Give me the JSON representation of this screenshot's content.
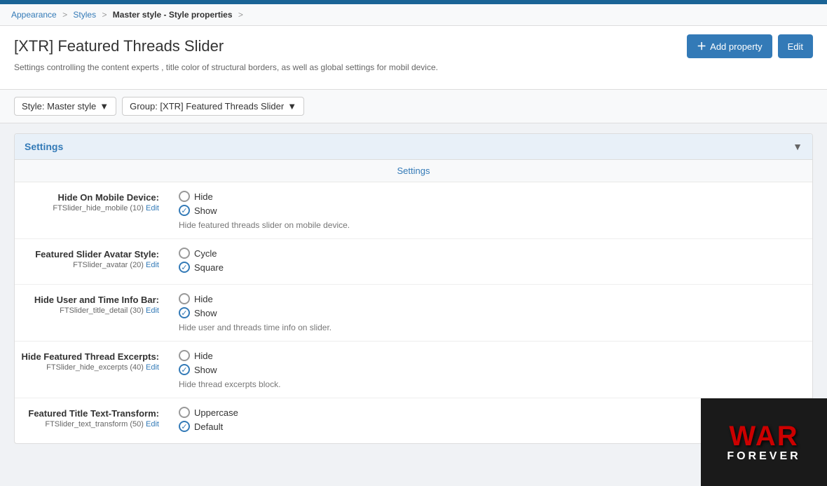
{
  "topbar": {
    "color": "#1a6496"
  },
  "breadcrumb": {
    "items": [
      {
        "label": "Appearance",
        "link": true
      },
      {
        "label": "Styles",
        "link": true
      },
      {
        "label": "Master style - Style properties",
        "link": true,
        "bold": true
      }
    ],
    "separator": ">"
  },
  "header": {
    "title": "[XTR] Featured Threads Slider",
    "description": "Settings controlling the content experts , title color of structural borders, as well as global settings for mobil device.",
    "add_property_label": "Add property",
    "edit_label": "Edit"
  },
  "filters": {
    "style_label": "Style: Master style",
    "group_label": "Group: [XTR] Featured Threads Slider"
  },
  "settings_panel": {
    "title": "Settings",
    "sub_header": "Settings",
    "rows": [
      {
        "label": "Hide On Mobile Device:",
        "sub": "FTSlider_hide_mobile (10)",
        "edit_link": "Edit",
        "options": [
          {
            "label": "Hide",
            "selected": false
          },
          {
            "label": "Show",
            "selected": true
          }
        ],
        "hint": "Hide featured threads slider on mobile device."
      },
      {
        "label": "Featured Slider Avatar Style:",
        "sub": "FTSlider_avatar (20)",
        "edit_link": "Edit",
        "options": [
          {
            "label": "Cycle",
            "selected": false
          },
          {
            "label": "Square",
            "selected": true
          }
        ],
        "hint": ""
      },
      {
        "label": "Hide User and Time Info Bar:",
        "sub": "FTSlider_title_detail (30)",
        "edit_link": "Edit",
        "options": [
          {
            "label": "Hide",
            "selected": false
          },
          {
            "label": "Show",
            "selected": true
          }
        ],
        "hint": "Hide user and threads time info on slider."
      },
      {
        "label": "Hide Featured Thread Excerpts:",
        "sub": "FTSlider_hide_excerpts (40)",
        "edit_link": "Edit",
        "options": [
          {
            "label": "Hide",
            "selected": false
          },
          {
            "label": "Show",
            "selected": true
          }
        ],
        "hint": "Hide thread excerpts block."
      },
      {
        "label": "Featured Title Text-Transform:",
        "sub": "FTSlider_text_transform (50)",
        "edit_link": "Edit",
        "options": [
          {
            "label": "Uppercase",
            "selected": false
          },
          {
            "label": "Default",
            "selected": true
          }
        ],
        "hint": ""
      }
    ]
  },
  "watermark": {
    "line1": "WAR",
    "line2": "FOREVER"
  }
}
